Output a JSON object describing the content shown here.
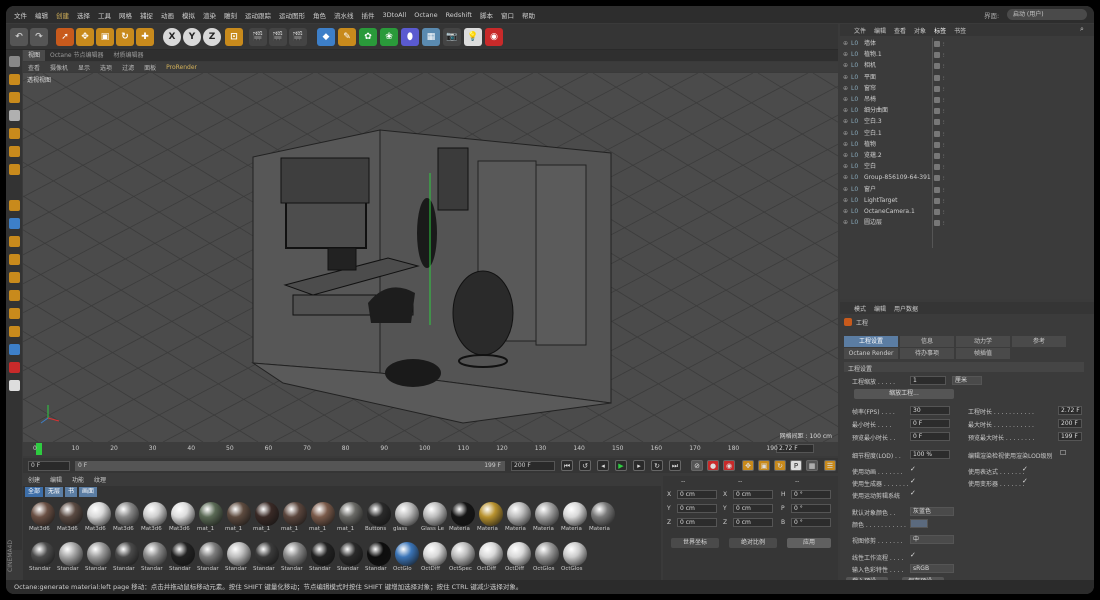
{
  "menu": {
    "items": [
      "文件",
      "编辑",
      "创建",
      "选择",
      "工具",
      "网格",
      "捕捉",
      "动画",
      "模拟",
      "渲染",
      "雕刻",
      "运动跟踪",
      "运动图形",
      "角色",
      "流水线",
      "插件",
      "3DtoAll",
      "Octane",
      "Redshift",
      "脚本",
      "窗口",
      "帮助"
    ],
    "layout_label": "界面:",
    "layout_value": "启动 (用户)"
  },
  "toolbar": {
    "axis_x": "X",
    "axis_y": "Y",
    "axis_z": "Z"
  },
  "viewport": {
    "tabs": [
      "视图",
      "Octane 节点编辑器",
      "材质编辑器"
    ],
    "menu": [
      "查看",
      "摄像机",
      "显示",
      "选项",
      "过滤",
      "面板",
      "ProRender"
    ],
    "title": "透视视图",
    "grid_readout": "网格间距 : 100 cm"
  },
  "timeline": {
    "ticks": [
      "0",
      "10",
      "20",
      "30",
      "40",
      "50",
      "60",
      "70",
      "80",
      "90",
      "100",
      "110",
      "120",
      "130",
      "140",
      "150",
      "160",
      "170",
      "180",
      "190"
    ],
    "end_frame": "2.72 F"
  },
  "transport": {
    "start": "0 F",
    "current": "0 F",
    "range_end": "199 F",
    "end": "200 F"
  },
  "materials": {
    "menu": [
      "创建",
      "编辑",
      "功能",
      "纹理"
    ],
    "filters": [
      "全部",
      "无层",
      "书",
      "画面"
    ],
    "row1": [
      "Mat3d6",
      "Mat3d6",
      "Mat3d6",
      "Mat3d6",
      "Mat3d6",
      "Mat3d6",
      "mat_1",
      "mat_1",
      "mat_1",
      "mat_1",
      "mat_1",
      "mat_1",
      "Buttons",
      "glass",
      "Glass Le",
      "Materia",
      "Materia",
      "Materia",
      "Materia",
      "Materia",
      "Materia"
    ],
    "row2": [
      "Standar",
      "Standar",
      "Standar",
      "Standar",
      "Standar",
      "Standar",
      "Standar",
      "Standar",
      "Standar",
      "Standar",
      "Standar",
      "Standar",
      "Standar",
      "OctGlo",
      "OctDiff",
      "OctSpec",
      "OctDiff",
      "OctDiff",
      "OctGlos",
      "OctGlos"
    ],
    "row1_colors": [
      "#6a5044",
      "#5a4a42",
      "#d8d8d8",
      "#888888",
      "#cfcfcf",
      "#dddddd",
      "#5a6a55",
      "#5e4b3f",
      "#3a2a26",
      "#5b463d",
      "#7a5a4a",
      "#6a6a66",
      "#2a2a2a",
      "#bcbcbc",
      "#bcbcbc",
      "#151515",
      "#b8922e",
      "#bdbdbd",
      "#a2a2a2",
      "#d8d8d8",
      "#7a7a7a"
    ],
    "row2_colors": [
      "#4c4c4c",
      "#a7a7a7",
      "#9c9c9c",
      "#4a4a4a",
      "#8a8a8a",
      "#222222",
      "#7c7c7c",
      "#bdbdbd",
      "#3b3b3b",
      "#8a8a8a",
      "#222222",
      "#2a2a2a",
      "#0d0d0d",
      "#3b75b8",
      "#d8d8d8",
      "#bcbcbc",
      "#d8d8d8",
      "#d8d8d8",
      "#9a9a9a",
      "#cccccc"
    ]
  },
  "coords": {
    "headers": [
      "--",
      "--",
      "--"
    ],
    "rows": [
      {
        "a": "X",
        "av": "0 cm",
        "b": "X",
        "bv": "0 cm",
        "c": "H",
        "cv": "0 °"
      },
      {
        "a": "Y",
        "av": "0 cm",
        "b": "Y",
        "bv": "0 cm",
        "c": "P",
        "cv": "0 °"
      },
      {
        "a": "Z",
        "av": "0 cm",
        "b": "Z",
        "bv": "0 cm",
        "c": "B",
        "cv": "0 °"
      }
    ],
    "mode1": "世界坐标",
    "mode2": "绝对比例",
    "apply": "应用"
  },
  "objects": {
    "menu": [
      "文件",
      "编辑",
      "查看",
      "对象",
      "标签",
      "书签"
    ],
    "items": [
      {
        "name": "墙体"
      },
      {
        "name": "植物.1"
      },
      {
        "name": "相机"
      },
      {
        "name": "平面"
      },
      {
        "name": "窗帘"
      },
      {
        "name": "吊椅"
      },
      {
        "name": "细分曲面"
      },
      {
        "name": "空白.3"
      },
      {
        "name": "空白.1"
      },
      {
        "name": "植物"
      },
      {
        "name": "览蕴.2"
      },
      {
        "name": "空白"
      },
      {
        "name": "Group-856109-64-391"
      },
      {
        "name": "窗户"
      },
      {
        "name": "LightTarget"
      },
      {
        "name": "OctaneCamera.1"
      },
      {
        "name": "圆边层"
      }
    ]
  },
  "attributes": {
    "menu": [
      "模式",
      "编辑",
      "用户数据"
    ],
    "heading": "工程",
    "tabs_row1": [
      "工程设置",
      "信息",
      "动力学",
      "参考"
    ],
    "tabs_row2": [
      "Octane Render",
      "待办事项",
      "帧插值"
    ],
    "section": "工程设置",
    "scale_label": "工程缩放 . . . . .",
    "scale_value": "1",
    "scale_unit": "厘米",
    "scale_button": "缩放工程...",
    "fps_label": "帧率(FPS) . . . .",
    "fps_value": "30",
    "duration_label": "工程时长 . . . . . . . . . . .",
    "duration_value": "2.72 F",
    "min_label": "最小时长 . . . .",
    "min_value": "0 F",
    "max_label": "最大时长 . . . . . . . . . . .",
    "max_value": "200 F",
    "pmin_label": "预览最小时长 . .",
    "pmin_value": "0 F",
    "pmax_label": "预览最大时长 . . . . . . . .",
    "pmax_value": "199 F",
    "lod_label": "细节程度(LOD) . .",
    "lod_value": "100 %",
    "lod_render_label": "编辑渲染检视使用渲染LOD级别",
    "anim_label": "使用动画 . . . . . . .",
    "expr_label": "使用表达式 . . . . . . .",
    "gen_label": "使用生成器 . . . . . . .",
    "deform_label": "使用变形器 . . . . . . .",
    "motion_label": "使用运动剪辑系统",
    "color_label": "默认对象颜色 . .",
    "color_value": "灰蓝色",
    "color2_label": "颜色 . . . . . . . . . . .",
    "clip_label": "视图修剪 . . . . . . .",
    "clip_value": "中",
    "linear_label": "线性工作流程 . . . .",
    "input_label": "输入色彩特性 . . . .",
    "input_value": "sRGB",
    "load_button": "载入预设...",
    "save_button": "保存预设..."
  },
  "status": {
    "text": "Octane:generate material:left page    移动：点击并拖动鼠标移动元素。按住 SHIFT 键量化移动；节点编辑模式时按住 SHIFT 键增加选择对象；按住 CTRL 键减少选择对象。"
  },
  "colors": {
    "accent": "#5b7da3",
    "highlight_menu": "#d4b25a",
    "green_handle": "#2ecc40"
  }
}
